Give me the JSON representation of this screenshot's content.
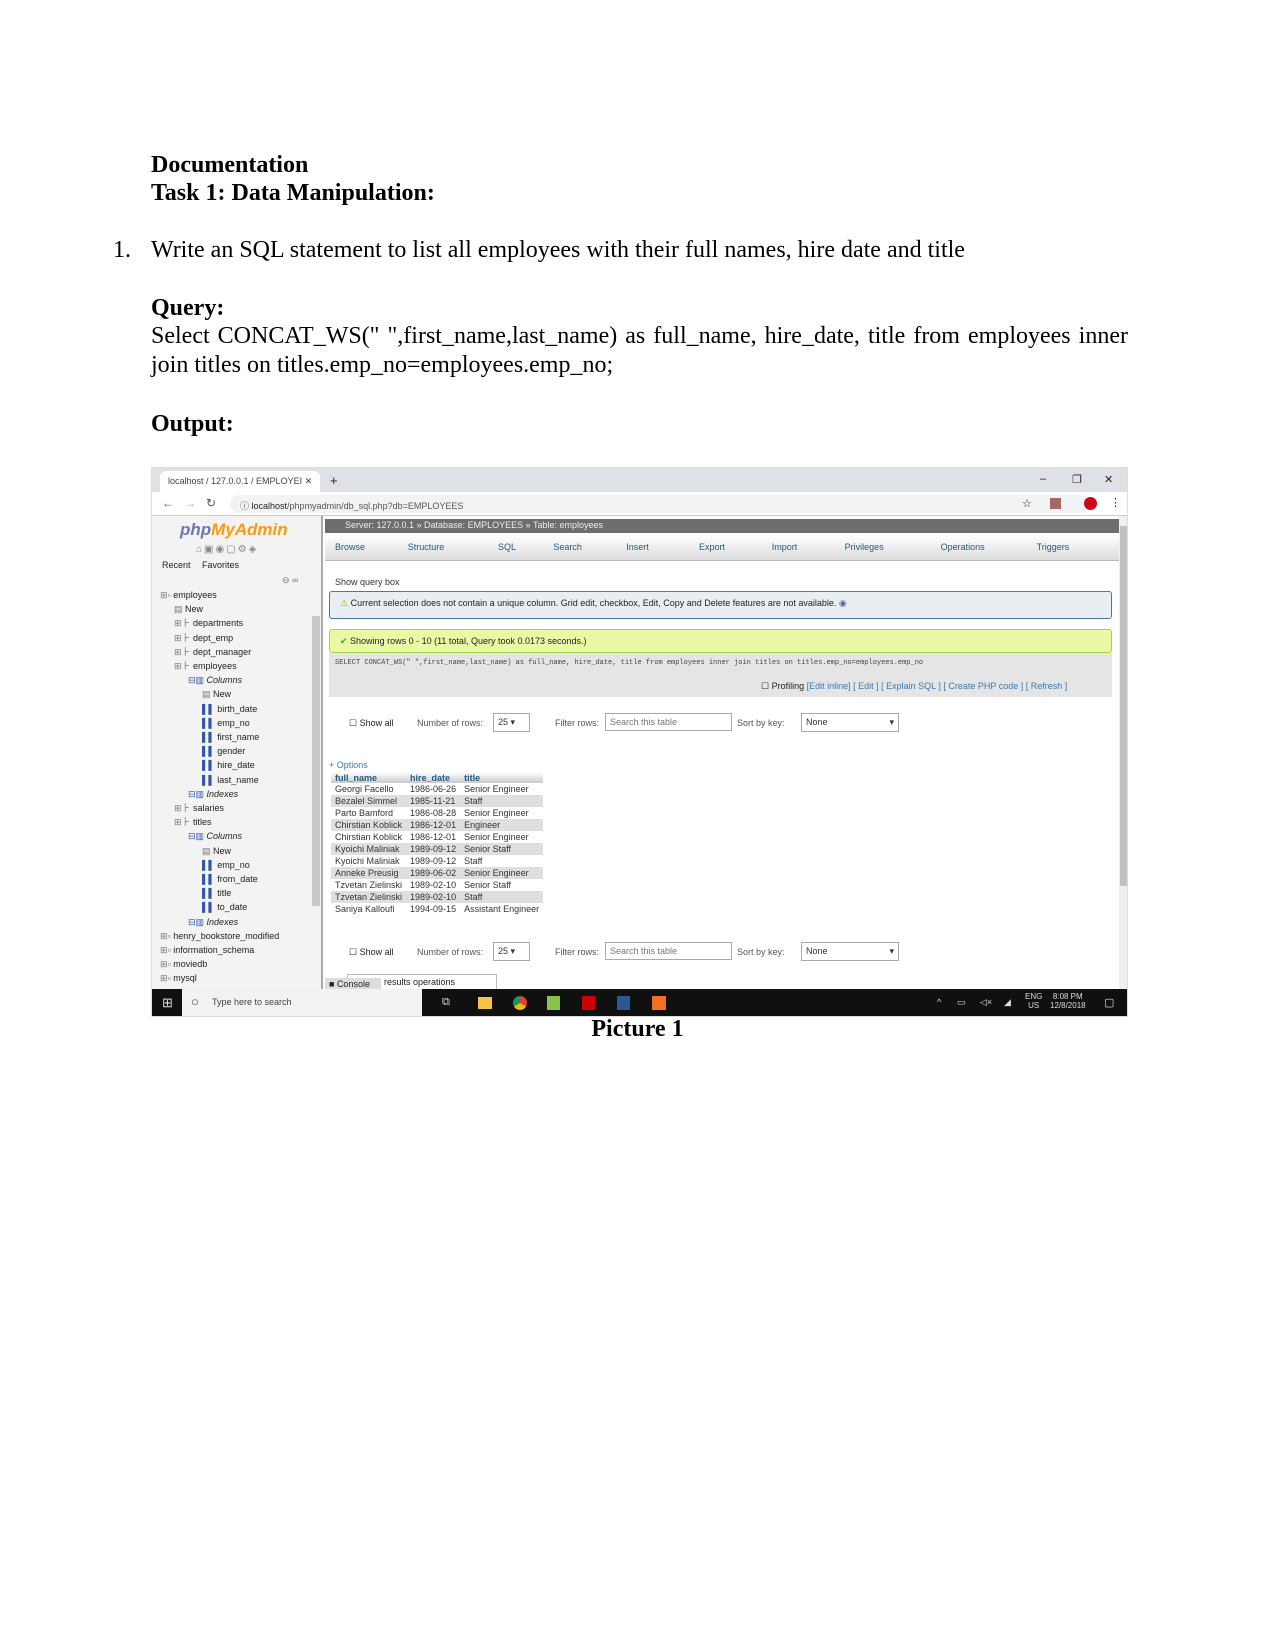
{
  "doc": {
    "heading": "Documentation",
    "task": "Task 1: Data Manipulation:",
    "item_number": "1.",
    "item_text": "Write an SQL statement to list all employees with their full names, hire date and title",
    "query_label": "Query:",
    "query_text": "Select CONCAT_WS(\" \",first_name,last_name) as full_name, hire_date, title from employees inner join titles on titles.emp_no=employees.emp_no;",
    "output_label": "Output:",
    "caption": "Picture 1"
  },
  "browser": {
    "tab_title": "localhost / 127.0.0.1 / EMPLOYEI",
    "new_tab": "+",
    "url_host": "localhost",
    "url_path": "/phpmyadmin/db_sql.php?db=EMPLOYEES",
    "minimize": "–",
    "restore": "❐",
    "close": "✕"
  },
  "sidebar": {
    "logo_php": "php",
    "logo_myadmin": "MyAdmin",
    "recent": "Recent",
    "favorites": "Favorites",
    "tree": [
      {
        "label": "employees",
        "level": 0,
        "kind": "db"
      },
      {
        "label": "New",
        "level": 1,
        "kind": "new"
      },
      {
        "label": "departments",
        "level": 1,
        "kind": "table"
      },
      {
        "label": "dept_emp",
        "level": 1,
        "kind": "table"
      },
      {
        "label": "dept_manager",
        "level": 1,
        "kind": "table"
      },
      {
        "label": "employees",
        "level": 1,
        "kind": "table"
      },
      {
        "label": "Columns",
        "level": 2,
        "kind": "group"
      },
      {
        "label": "New",
        "level": 3,
        "kind": "new"
      },
      {
        "label": "birth_date",
        "level": 3,
        "kind": "col"
      },
      {
        "label": "emp_no",
        "level": 3,
        "kind": "col"
      },
      {
        "label": "first_name",
        "level": 3,
        "kind": "col"
      },
      {
        "label": "gender",
        "level": 3,
        "kind": "col"
      },
      {
        "label": "hire_date",
        "level": 3,
        "kind": "col"
      },
      {
        "label": "last_name",
        "level": 3,
        "kind": "col"
      },
      {
        "label": "Indexes",
        "level": 2,
        "kind": "group"
      },
      {
        "label": "salaries",
        "level": 1,
        "kind": "table"
      },
      {
        "label": "titles",
        "level": 1,
        "kind": "table"
      },
      {
        "label": "Columns",
        "level": 2,
        "kind": "group"
      },
      {
        "label": "New",
        "level": 3,
        "kind": "new"
      },
      {
        "label": "emp_no",
        "level": 3,
        "kind": "col"
      },
      {
        "label": "from_date",
        "level": 3,
        "kind": "col"
      },
      {
        "label": "title",
        "level": 3,
        "kind": "col"
      },
      {
        "label": "to_date",
        "level": 3,
        "kind": "col"
      },
      {
        "label": "Indexes",
        "level": 2,
        "kind": "group"
      },
      {
        "label": "henry_bookstore_modified",
        "level": 0,
        "kind": "db"
      },
      {
        "label": "information_schema",
        "level": 0,
        "kind": "db"
      },
      {
        "label": "moviedb",
        "level": 0,
        "kind": "db"
      },
      {
        "label": "mysql",
        "level": 0,
        "kind": "db"
      }
    ]
  },
  "main": {
    "breadcrumb": "Server: 127.0.0.1 » Database: EMPLOYEES » Table: employees",
    "tabs": [
      "Browse",
      "Structure",
      "SQL",
      "Search",
      "Insert",
      "Export",
      "Import",
      "Privileges",
      "Operations",
      "Triggers"
    ],
    "show_query_box": "Show query box",
    "warning": "Current selection does not contain a unique column. Grid edit, checkbox, Edit, Copy and Delete features are not available.",
    "success": "Showing rows 0 - 10 (11 total, Query took 0.0173 seconds.)",
    "sql": "SELECT CONCAT_WS(\" \",first_name,last_name) as full_name, hire_date, title from employees inner join titles on titles.emp_no=employees.emp_no",
    "profiling": "Profiling",
    "links": "[Edit inline] [ Edit ] [ Explain SQL ] [ Create PHP code ] [ Refresh ]",
    "show_all": "Show all",
    "number_of_rows": "Number of rows:",
    "rows_value": "25 ▾",
    "filter_rows": "Filter rows:",
    "filter_placeholder": "Search this table",
    "sort_by_key": "Sort by key:",
    "sort_value": "None",
    "options": "+ Options",
    "columns": [
      "full_name",
      "hire_date",
      "title"
    ],
    "rows": [
      [
        "Georgi Facello",
        "1986-06-26",
        "Senior Engineer"
      ],
      [
        "Bezalel Simmel",
        "1985-11-21",
        "Staff"
      ],
      [
        "Parto Bamford",
        "1986-08-28",
        "Senior Engineer"
      ],
      [
        "Chirstian Koblick",
        "1986-12-01",
        "Engineer"
      ],
      [
        "Chirstian Koblick",
        "1986-12-01",
        "Senior Engineer"
      ],
      [
        "Kyoichi Maliniak",
        "1989-09-12",
        "Senior Staff"
      ],
      [
        "Kyoichi Maliniak",
        "1989-09-12",
        "Staff"
      ],
      [
        "Anneke Preusig",
        "1989-06-02",
        "Senior Engineer"
      ],
      [
        "Tzvetan Zielinski",
        "1989-02-10",
        "Senior Staff"
      ],
      [
        "Tzvetan Zielinski",
        "1989-02-10",
        "Staff"
      ],
      [
        "Saniya Kalloufi",
        "1994-09-15",
        "Assistant Engineer"
      ]
    ],
    "console": "Console",
    "results_ops": "results operations"
  },
  "taskbar": {
    "search_placeholder": "Type here to search",
    "lang1": "ENG",
    "lang2": "US",
    "time": "8:08 PM",
    "date": "12/8/2018"
  }
}
